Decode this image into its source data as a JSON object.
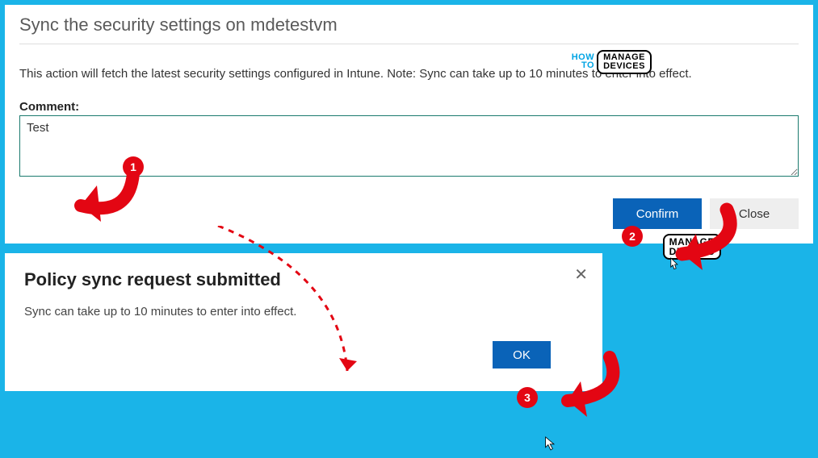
{
  "dialog": {
    "title": "Sync the security settings on mdetestvm",
    "description": "This action will fetch the latest security settings configured in Intune. Note: Sync can take up to 10 minutes to enter into effect.",
    "comment_label": "Comment:",
    "comment_value": "Test",
    "confirm_label": "Confirm",
    "close_label": "Close"
  },
  "result": {
    "title": "Policy sync request submitted",
    "description": "Sync can take up to 10 minutes to enter into effect.",
    "ok_label": "OK",
    "close_glyph": "✕"
  },
  "watermark": {
    "how": "HOW",
    "to": "TO",
    "manage": "MANAGE",
    "devices": "DEVICES"
  },
  "annotations": {
    "step1": "1",
    "step2": "2",
    "step3": "3"
  }
}
